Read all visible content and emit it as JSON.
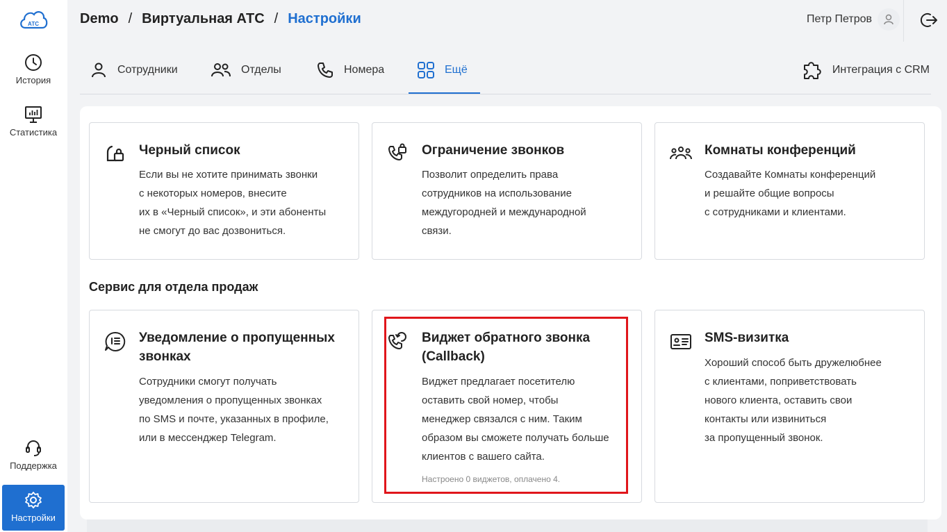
{
  "sidebar": {
    "logo_text": "АТС",
    "items": [
      {
        "label": "История",
        "icon": "clock-icon"
      },
      {
        "label": "Статистика",
        "icon": "chart-monitor-icon"
      },
      {
        "label": "Поддержка",
        "icon": "headset-icon"
      },
      {
        "label": "Настройки",
        "icon": "gear-icon",
        "active": true
      }
    ]
  },
  "header": {
    "breadcrumbs": [
      "Demo",
      "Виртуальная АТС",
      "Настройки"
    ],
    "separator": "/",
    "user_name": "Петр Петров"
  },
  "tabs": [
    {
      "label": "Сотрудники",
      "icon": "person-icon"
    },
    {
      "label": "Отделы",
      "icon": "people-icon"
    },
    {
      "label": "Номера",
      "icon": "phone-icon"
    },
    {
      "label": "Ещё",
      "icon": "grid-icon",
      "active": true
    }
  ],
  "crm": {
    "label": "Интеграция с CRM",
    "icon": "puzzle-icon"
  },
  "cards_top": [
    {
      "title": "Черный список",
      "desc_lines": [
        "Если вы не хотите принимать звонки",
        "с некоторых номеров, внесите",
        "их в «Черный список», и эти абоненты",
        "не смогут до вас дозвониться."
      ],
      "icon": "lock-icon"
    },
    {
      "title": "Ограничение звонков",
      "desc_lines": [
        "Позволит определить права",
        "сотрудников на использование",
        "междугородней и международной",
        "связи."
      ],
      "icon": "phone-lock-icon"
    },
    {
      "title": "Комнаты конференций",
      "desc_lines": [
        "Создавайте Комнаты конференций",
        "и решайте общие вопросы",
        "с сотрудниками и клиентами."
      ],
      "icon": "group-icon"
    }
  ],
  "section_title": "Сервис для отдела продаж",
  "cards_bottom": [
    {
      "title_lines": [
        "Уведомление о пропущенных",
        "звонках"
      ],
      "desc_lines": [
        "Сотрудники смогут получать",
        "уведомления о пропущенных звонках",
        "по SMS и почте, указанных в профиле,",
        "или в мессенджер Telegram."
      ],
      "icon": "notification-bubble-icon"
    },
    {
      "title_lines": [
        "Виджет обратного звонка",
        "(Callback)"
      ],
      "desc_lines": [
        "Виджет предлагает посетителю",
        "оставить свой номер, чтобы",
        "менеджер связался с ним. Таким",
        "образом вы сможете получать больше",
        "клиентов с вашего сайта."
      ],
      "note": "Настроено 0 виджетов, оплачено 4.",
      "icon": "callback-icon"
    },
    {
      "title_lines": [
        "SMS-визитка"
      ],
      "desc_lines": [
        "Хороший способ быть дружелюбнее",
        "с клиентами, поприветствовать",
        "нового клиента, оставить свои",
        "контакты или извиниться",
        "за пропущенный звонок."
      ],
      "icon": "id-card-icon"
    }
  ],
  "colors": {
    "accent": "#1f6fd0",
    "highlight": "#e0161b"
  }
}
